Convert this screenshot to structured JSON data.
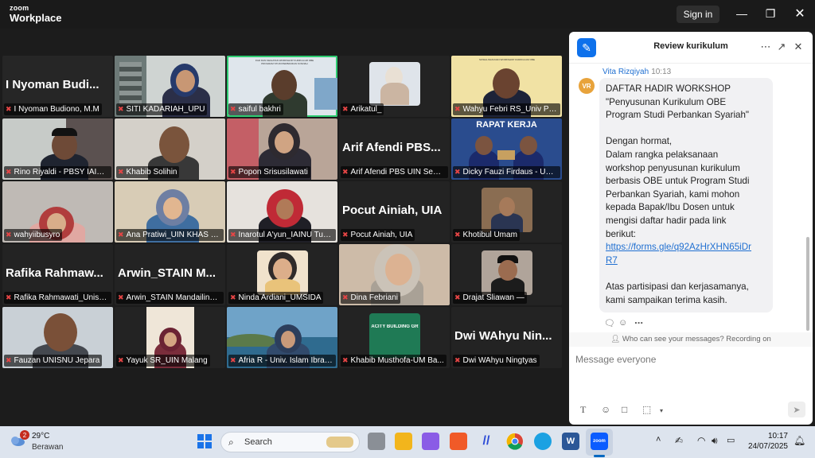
{
  "app": {
    "brand_top": "zoom",
    "brand_bottom": "Workplace",
    "sign_in": "Sign in"
  },
  "participants": [
    {
      "label": "I Nyoman Budiono, M.M",
      "big": "I Nyoman Budi..."
    },
    {
      "label": "SITI KADARIAH_UPU",
      "big": ""
    },
    {
      "label": "saiful bakhri",
      "big": ""
    },
    {
      "label": "Arikatul_",
      "big": ""
    },
    {
      "label": "Wahyu Febri RS_Univ Pah...",
      "big": ""
    },
    {
      "label": "Rino Riyaldi - PBSY IAIN ...",
      "big": ""
    },
    {
      "label": "Khabib Solihin",
      "big": ""
    },
    {
      "label": "Popon Srisusilawati",
      "big": ""
    },
    {
      "label": "Arif Afendi PBS UIN Sema...",
      "big": "Arif Afendi PBS..."
    },
    {
      "label": "Dicky Fauzi Firdaus - UNI...",
      "big": ""
    },
    {
      "label": "wahyiibusyro",
      "big": ""
    },
    {
      "label": "Ana Pratiwi_UIN KHAS Je...",
      "big": ""
    },
    {
      "label": "Inarotul A'yun_IAINU Tub...",
      "big": ""
    },
    {
      "label": "Pocut Ainiah, UIA",
      "big": "Pocut Ainiah, UIA"
    },
    {
      "label": "Khotibul Umam",
      "big": ""
    },
    {
      "label": "Rafika Rahmawati_Unism...",
      "big": "Rafika  Rahmaw..."
    },
    {
      "label": "Arwin_STAIN Mandailing ...",
      "big": "Arwin_STAIN  M..."
    },
    {
      "label": "Ninda Ardiani_UMSIDA",
      "big": ""
    },
    {
      "label": "Dina Febriani",
      "big": ""
    },
    {
      "label": "Drajat Sliawan —",
      "big": ""
    },
    {
      "label": "Fauzan UNISNU Jepara",
      "big": ""
    },
    {
      "label": "Yayuk SR_UIN Malang",
      "big": ""
    },
    {
      "label": "Afria R - Univ. Islam Ibrah...",
      "big": ""
    },
    {
      "label": "Khabib Musthofa-UM Ba...",
      "big": ""
    },
    {
      "label": "Dwi WAhyu Ningtyas",
      "big": "Dwi WAhyu Nin..."
    }
  ],
  "tile_text": {
    "rapat": "RAPAT KERJA",
    "capacity": "ACITY BUILDING GR"
  },
  "chat": {
    "title": "Review kurikulum",
    "sender": "Vita Rizqiyah",
    "time": "10:13",
    "avatar": "VR",
    "lines": [
      "DAFTAR HADIR WORKSHOP",
      "\"Penyusunan Kurikulum OBE",
      "Program Studi Perbankan Syariah\"",
      "Dengan hormat,",
      "Dalam rangka pelaksanaan",
      "workshop penyusunan kurikulum",
      "berbasis OBE untuk Program Studi",
      "Perbankan Syariah, kami mohon",
      "kepada Bapak/Ibu Dosen untuk",
      "mengisi daftar hadir pada link",
      "berikut:",
      "https://forms.gle/q92AzHrXHN65iDr",
      "R7",
      "Atas partisipasi dan kerjasamanya,",
      "kami sampaikan terima kasih."
    ],
    "privacy": "Who can see your messages? Recording on",
    "placeholder": "Message everyone"
  },
  "taskbar": {
    "weather_badge": "2",
    "temp": "29°C",
    "condition": "Berawan",
    "search": "Search",
    "time": "10:17",
    "date": "24/07/2025",
    "zoom_app_label": "zoom"
  }
}
